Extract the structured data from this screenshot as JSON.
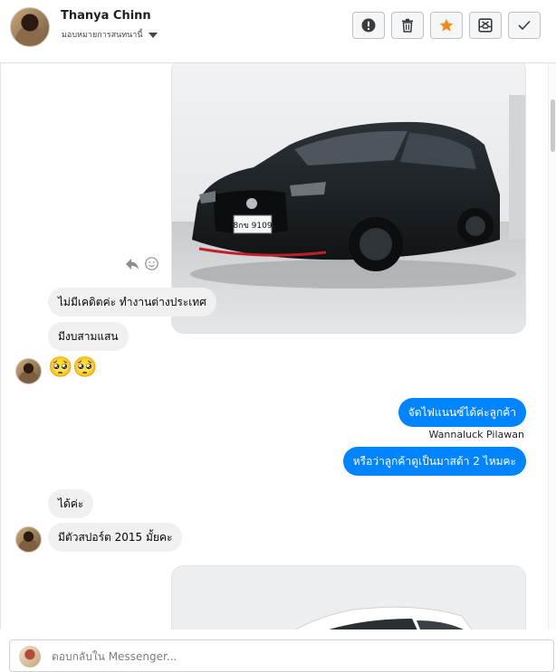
{
  "header": {
    "contact_name": "Thanya Chinn",
    "status_text": "มอบหมายการสนทนานี้"
  },
  "icons": {
    "report": "exclamation-circle-icon",
    "delete": "trash-icon",
    "star": "star-icon",
    "archive": "archive-icon",
    "done": "checkmark-icon",
    "reply": "reply-icon",
    "react": "smiley-icon"
  },
  "colors": {
    "outgoing_bubble": "#0084ff",
    "incoming_bubble": "#f0f0f0",
    "star": "#f28c18"
  },
  "messages": {
    "m1": "ไม่มีเคดิตค่ะ ทำงานต่างประเทศ",
    "m2": "มีงบสามแสน",
    "m3_emoji": "🥺🥺",
    "m4": "จัดไฟแนนซ์ได้ค่ะลูกค้า",
    "m4_sender": "Wannaluck Pilawan",
    "m5": "หรือว่าลูกค้าดูเป็นมาสด้า 2 ไหมคะ",
    "m6": "ได้ค่ะ",
    "m7": "มีตัวสปอร์ต 2015 มั้ยคะ",
    "plate_text": "8กข 9109"
  },
  "composer": {
    "placeholder": "ตอบกลับใน Messenger..."
  }
}
